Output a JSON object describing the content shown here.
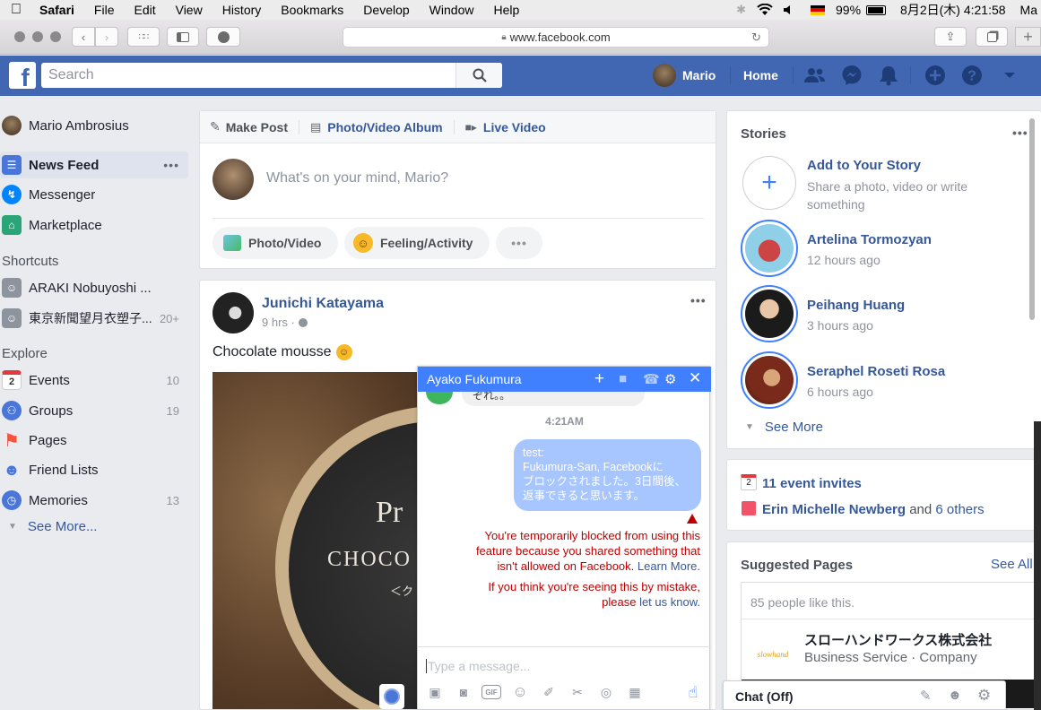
{
  "menubar": {
    "apple": "",
    "items": [
      "Safari",
      "File",
      "Edit",
      "View",
      "History",
      "Bookmarks",
      "Develop",
      "Window",
      "Help"
    ],
    "battery": "99%",
    "battery_icon": "",
    "datetime": "8月2日(木)  4:21:58",
    "user": "Ma"
  },
  "safari": {
    "url": "www.facebook.com"
  },
  "fb": {
    "logo": "f",
    "search_placeholder": "Search",
    "user_name": "Mario",
    "home": "Home"
  },
  "left_nav": {
    "profile": "Mario Ambrosius",
    "items": [
      {
        "label": "News Feed",
        "count": ""
      },
      {
        "label": "Messenger",
        "count": ""
      },
      {
        "label": "Marketplace",
        "count": ""
      }
    ],
    "more_dots": "•••",
    "shortcuts_title": "Shortcuts",
    "shortcuts": [
      {
        "label": "ARAKI Nobuyoshi ...",
        "count": ""
      },
      {
        "label": "東京新聞望月衣塑子...",
        "count": "20+"
      }
    ],
    "explore_title": "Explore",
    "explore": [
      {
        "label": "Events",
        "count": "10"
      },
      {
        "label": "Groups",
        "count": "19"
      },
      {
        "label": "Pages",
        "count": ""
      },
      {
        "label": "Friend Lists",
        "count": ""
      },
      {
        "label": "Memories",
        "count": "13"
      }
    ],
    "see_more": "See More...",
    "events_icon_num": "2"
  },
  "composer": {
    "make_post": "Make Post",
    "album": "Photo/Video Album",
    "live": "Live Video",
    "placeholder": "What's on your mind, Mario?",
    "photo_video": "Photo/Video",
    "feeling": "Feeling/Activity",
    "more": "•••"
  },
  "post": {
    "author": "Junichi Katayama",
    "time": "9 hrs ·",
    "text": "Chocolate mousse",
    "image_text1": "Pr",
    "image_text2": "CHOCO",
    "image_text3": "＜ク",
    "more": "•••"
  },
  "chat": {
    "name": "Ayako Fukumura",
    "partial_msg": "ぞれ。。",
    "time": "4:21AM",
    "msg_line1": "test:",
    "msg_line2": "Fukumura-San, Facebookに",
    "msg_line3": "ブロックされました。3日間後、",
    "msg_line4": "返事できると思います。",
    "warn_icon": "!",
    "error1a": "You're temporarily blocked from using this",
    "error1b": "feature because you shared something that",
    "error1c": "isn't allowed on Facebook.",
    "learn_more": "Learn More.",
    "error2a": "If you think you're seeing this by mistake,",
    "error2b": "please",
    "let_us_know": "let us know.",
    "input_placeholder": "Type a message...",
    "gif": "GIF"
  },
  "stories": {
    "title": "Stories",
    "more": "•••",
    "add_title": "Add to Your Story",
    "add_sub1": "Share a photo, video or write",
    "add_sub2": "something",
    "items": [
      {
        "name": "Artelina Tormozyan",
        "time": "12 hours ago"
      },
      {
        "name": "Peihang Huang",
        "time": "3 hours ago"
      },
      {
        "name": "Seraphel Roseti Rosa",
        "time": "6 hours ago"
      }
    ],
    "see_more": "See More"
  },
  "events": {
    "invites": "11 event invites",
    "icon_num": "2",
    "birthday_name": "Erin Michelle Newberg",
    "and": "and",
    "others": "6 others"
  },
  "suggested": {
    "title": "Suggested Pages",
    "see_all": "See All",
    "likes": "85 people like this.",
    "page_name": "スローハンドワークス株式会社",
    "page_type": "Business Service · Company",
    "logo_text": "slowhand"
  },
  "chat_bar": {
    "label": "Chat (Off)"
  },
  "colors": {
    "fb_blue": "#4267b2",
    "messenger_blue": "#4080ff",
    "error_red": "#be0000",
    "link": "#365899"
  }
}
